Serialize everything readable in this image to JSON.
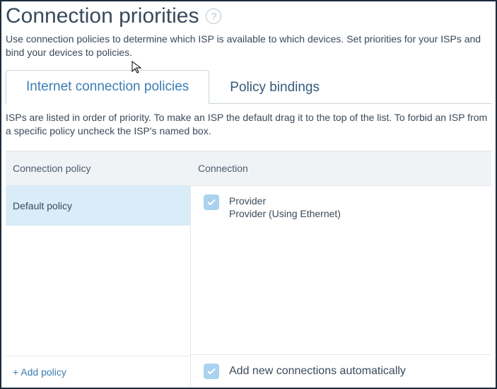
{
  "header": {
    "title": "Connection priorities",
    "intro": "Use connection policies to determine which ISP is available to which devices. Set priorities for your ISPs and bind your devices to policies."
  },
  "tabs": {
    "policies": "Internet connection policies",
    "bindings": "Policy bindings"
  },
  "tab_content": {
    "desc": "ISPs are listed in order of priority. To make an ISP the default drag it to the top of the list. To forbid an ISP from a specific policy uncheck the ISP's named box."
  },
  "columns": {
    "policy": "Connection policy",
    "connection": "Connection"
  },
  "policies": {
    "default": "Default policy",
    "add": "+ Add policy"
  },
  "connections": {
    "provider_name": "Provider",
    "provider_detail": "Provider (Using Ethernet)"
  },
  "footer": {
    "auto_add": "Add new connections automatically"
  }
}
